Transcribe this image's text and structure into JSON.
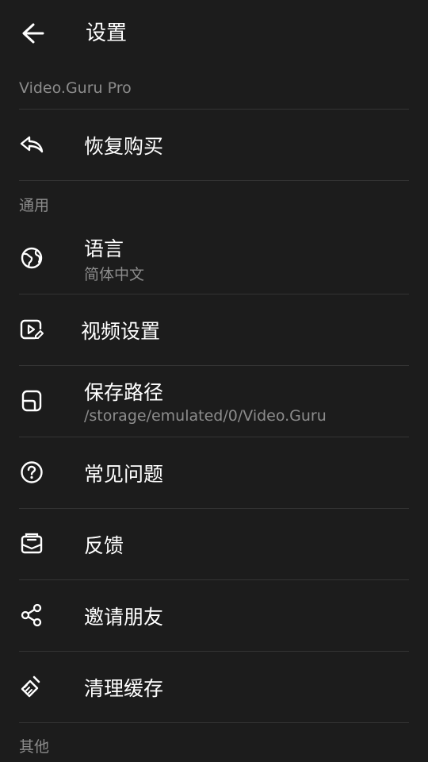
{
  "header": {
    "back_icon": "arrow-left-icon",
    "title": "设置"
  },
  "sections": {
    "pro": "Video.Guru Pro",
    "general": "通用",
    "other": "其他"
  },
  "items": {
    "restore": {
      "label": "恢复购买",
      "icon": "reply-arrow-icon"
    },
    "language": {
      "label": "语言",
      "value": "简体中文",
      "icon": "globe-icon"
    },
    "video_settings": {
      "label": "视频设置",
      "icon": "video-settings-icon"
    },
    "save_path": {
      "label": "保存路径",
      "value": "/storage/emulated/0/Video.Guru",
      "icon": "folder-icon"
    },
    "faq": {
      "label": "常见问题",
      "icon": "question-circle-icon"
    },
    "feedback": {
      "label": "反馈",
      "icon": "mail-icon"
    },
    "invite": {
      "label": "邀请朋友",
      "icon": "share-icon"
    },
    "clear_cache": {
      "label": "清理缓存",
      "icon": "broom-icon"
    }
  },
  "colors": {
    "background": "#1c1c1c",
    "text_primary": "#ffffff",
    "text_secondary": "#8c8c8c",
    "divider": "#343434"
  }
}
